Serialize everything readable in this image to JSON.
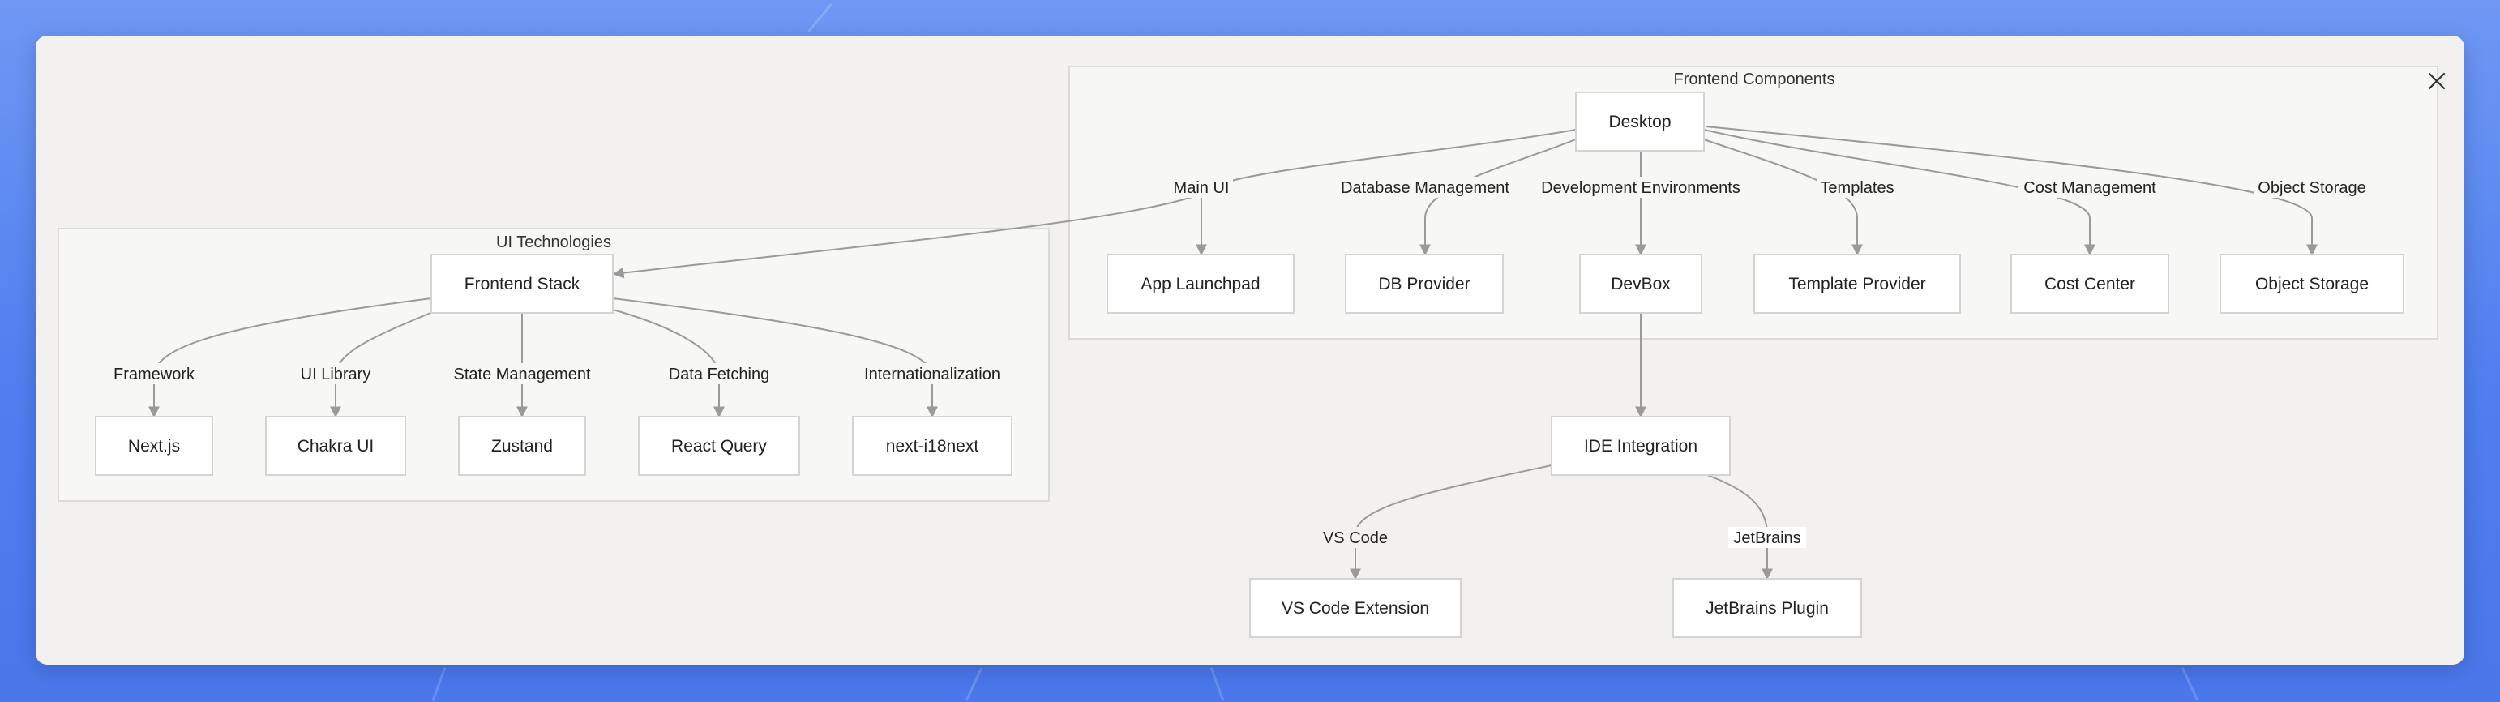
{
  "clusters": {
    "frontend": "Frontend Components",
    "ui": "UI Technologies"
  },
  "nodes": {
    "desktop": "Desktop",
    "app_launchpad": "App Launchpad",
    "db_provider": "DB Provider",
    "devbox": "DevBox",
    "template_provider": "Template Provider",
    "cost_center": "Cost Center",
    "object_storage": "Object Storage",
    "frontend_stack": "Frontend Stack",
    "nextjs": "Next.js",
    "chakra": "Chakra UI",
    "zustand": "Zustand",
    "react_query": "React Query",
    "i18next": "next-i18next",
    "ide": "IDE Integration",
    "vscode_ext": "VS Code Extension",
    "jetbrains_plugin": "JetBrains Plugin"
  },
  "edges": {
    "main_ui": "Main UI",
    "db_mgmt": "Database Management",
    "dev_env": "Development Environments",
    "templates": "Templates",
    "cost_mgmt": "Cost Management",
    "obj_storage": "Object Storage",
    "framework": "Framework",
    "ui_library": "UI Library",
    "state_mgmt": "State Management",
    "data_fetching": "Data Fetching",
    "i18n": "Internationalization",
    "vscode": "VS Code",
    "jetbrains": "JetBrains"
  },
  "icons": {
    "close": "close-icon"
  }
}
